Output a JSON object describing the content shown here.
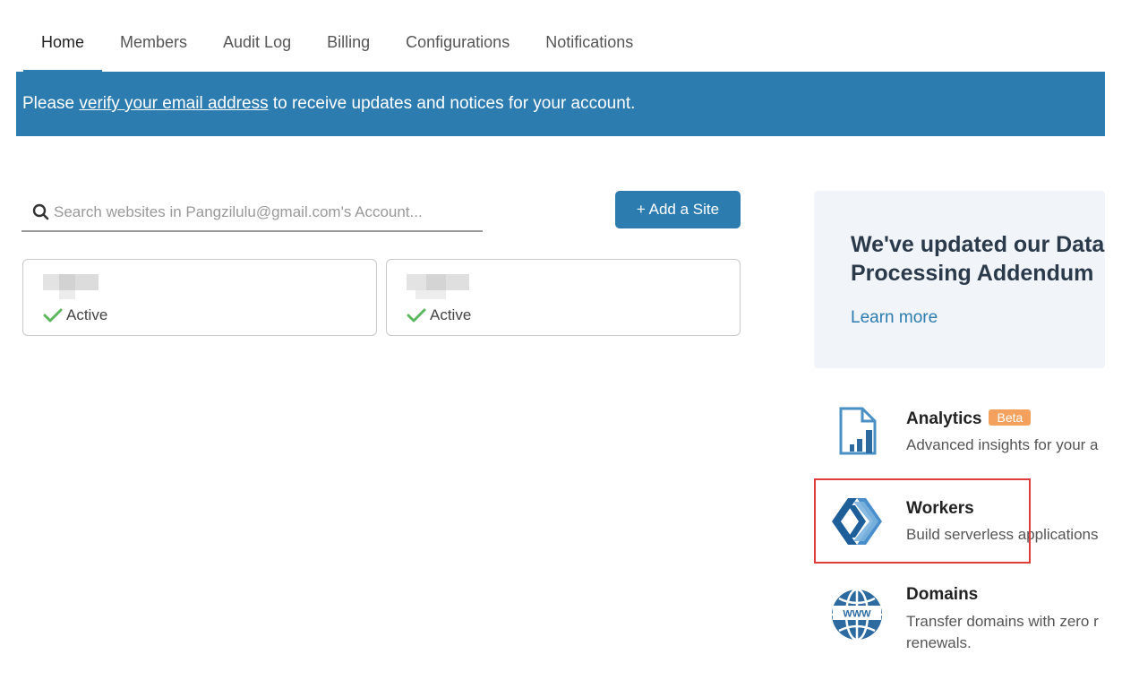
{
  "nav": {
    "tabs": [
      {
        "label": "Home",
        "active": true
      },
      {
        "label": "Members"
      },
      {
        "label": "Audit Log"
      },
      {
        "label": "Billing"
      },
      {
        "label": "Configurations"
      },
      {
        "label": "Notifications"
      }
    ]
  },
  "banner": {
    "prefix": "Please ",
    "link": "verify your email address",
    "suffix": " to receive updates and notices for your account."
  },
  "search": {
    "placeholder": "Search websites in Pangzilulu@gmail.com's Account..."
  },
  "add_site": {
    "label": "+ Add a Site"
  },
  "sites": [
    {
      "status": "Active"
    },
    {
      "status": "Active"
    }
  ],
  "promo": {
    "title_line1": "We've updated our Data",
    "title_line2": "Processing Addendum",
    "link": "Learn more"
  },
  "products": [
    {
      "name": "Analytics",
      "badge": "Beta",
      "desc": "Advanced insights for your a",
      "icon": "analytics-icon"
    },
    {
      "name": "Workers",
      "desc": "Build serverless applications",
      "icon": "workers-icon"
    },
    {
      "name": "Domains",
      "desc_line1": "Transfer domains with zero r",
      "desc_line2": "renewals.",
      "icon": "globe-www-icon"
    }
  ],
  "colors": {
    "accent": "#2c7cb0",
    "badge": "#f4a15d",
    "success": "#5cb85c",
    "highlight": "#e03c3c"
  }
}
